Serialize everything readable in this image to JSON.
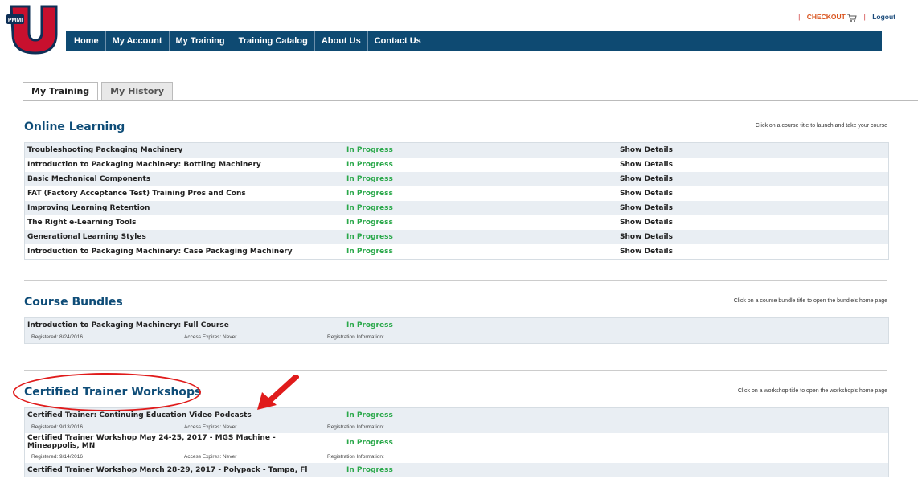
{
  "logo_text": "PMMI",
  "top_links": {
    "checkout": "CHECKOUT",
    "logout": "Logout"
  },
  "nav": [
    "Home",
    "My Account",
    "My Training",
    "Training Catalog",
    "About Us",
    "Contact Us"
  ],
  "tabs": [
    "My Training",
    "My History"
  ],
  "online": {
    "title": "Online Learning",
    "hint": "Click on a course title to launch and take your course",
    "rows": [
      {
        "title": "Troubleshooting Packaging Machinery",
        "status": "In Progress",
        "action": "Show Details"
      },
      {
        "title": "Introduction to Packaging Machinery: Bottling Machinery",
        "status": "In Progress",
        "action": "Show Details"
      },
      {
        "title": "Basic Mechanical Components",
        "status": "In Progress",
        "action": "Show Details"
      },
      {
        "title": "FAT (Factory Acceptance Test) Training Pros and Cons",
        "status": "In Progress",
        "action": "Show Details"
      },
      {
        "title": "Improving Learning Retention",
        "status": "In Progress",
        "action": "Show Details"
      },
      {
        "title": "The Right e-Learning Tools",
        "status": "In Progress",
        "action": "Show Details"
      },
      {
        "title": "Generational Learning Styles",
        "status": "In Progress",
        "action": "Show Details"
      },
      {
        "title": "Introduction to Packaging Machinery: Case Packaging Machinery",
        "status": "In Progress",
        "action": "Show Details"
      }
    ]
  },
  "bundles": {
    "title": "Course Bundles",
    "hint": "Click on a course bundle title to open the bundle's home page",
    "rows": [
      {
        "title": "Introduction to Packaging Machinery: Full Course",
        "status": "In Progress",
        "registered": "Registered: 8/24/2016",
        "expires": "Access Expires: Never",
        "info": "Registration Information:"
      }
    ]
  },
  "workshops": {
    "title": "Certified Trainer Workshops",
    "hint": "Click on a workshop title to open the workshop's home page",
    "rows": [
      {
        "title": "Certified Trainer: Continuing Education Video Podcasts",
        "status": "In Progress",
        "registered": "Registered: 9/13/2016",
        "expires": "Access Expires: Never",
        "info": "Registration Information:"
      },
      {
        "title": "Certified Trainer Workshop May 24-25, 2017 - MGS Machine - Mineappolis, MN",
        "status": "In Progress",
        "registered": "Registered: 9/14/2016",
        "expires": "Access Expires: Never",
        "info": "Registration Information:"
      },
      {
        "title": "Certified Trainer Workshop March 28-29, 2017 - Polypack - Tampa, Fl",
        "status": "In Progress"
      }
    ]
  },
  "colors": {
    "nav_bg": "#0e4a72",
    "title": "#0f4d78",
    "status": "#2aa84a",
    "annotation": "#e01b1b",
    "row_alt": "#e9eef3"
  }
}
